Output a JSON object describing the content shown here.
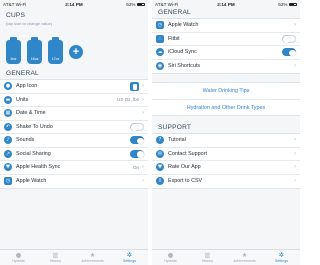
{
  "status": {
    "carrier": "AT&T Wi-Fi",
    "time": "2:14 PM",
    "battery": "62%"
  },
  "left": {
    "cups_title": "CUPS",
    "cups_hint": "(tap icon to change value)",
    "cups": [
      "8oz",
      "16oz",
      "17oz"
    ],
    "general_title": "GENERAL",
    "rows": [
      {
        "label": "App Icon",
        "icon": "water-drop-icon"
      },
      {
        "label": "Units",
        "value": "US Oz, lbs",
        "icon": "ruler-icon"
      },
      {
        "label": "Date & Time",
        "icon": "calendar-icon"
      },
      {
        "label": "Shake To Undo",
        "toggle": false,
        "icon": "shake-icon"
      },
      {
        "label": "Sounds",
        "toggle": true,
        "icon": "speaker-icon"
      },
      {
        "label": "Social Sharing",
        "toggle": true,
        "icon": "share-icon"
      },
      {
        "label": "Apple Health Sync",
        "value": "On",
        "icon": "heart-icon"
      },
      {
        "label": "Apple Watch",
        "icon": "watch-icon"
      }
    ]
  },
  "right": {
    "general_title": "GENERAL",
    "rows": [
      {
        "label": "Apple Watch",
        "icon": "watch-icon"
      },
      {
        "label": "Fitbit",
        "toggle": false,
        "icon": "fitbit-icon"
      },
      {
        "label": "iCloud Sync",
        "toggle": true,
        "icon": "cloud-icon"
      },
      {
        "label": "Siri Shortcuts",
        "icon": "siri-icon"
      }
    ],
    "links": [
      "Water Drinking Tips",
      "Hydration and Other Drink Types"
    ],
    "support_title": "SUPPORT",
    "support_rows": [
      {
        "label": "Tutorial",
        "icon": "question-icon"
      },
      {
        "label": "Contact Support",
        "icon": "mail-icon"
      },
      {
        "label": "Rate Our App",
        "icon": "heart-icon"
      },
      {
        "label": "Export to CSV",
        "icon": "export-icon"
      }
    ]
  },
  "tabs": [
    {
      "label": "Hydrate",
      "icon": "drop-icon"
    },
    {
      "label": "History",
      "icon": "history-icon"
    },
    {
      "label": "Achievements",
      "icon": "star-icon"
    },
    {
      "label": "Settings",
      "icon": "gear-icon",
      "active": true
    }
  ],
  "colors": {
    "accent": "#2f86c9",
    "background": "#f4f6f8"
  }
}
